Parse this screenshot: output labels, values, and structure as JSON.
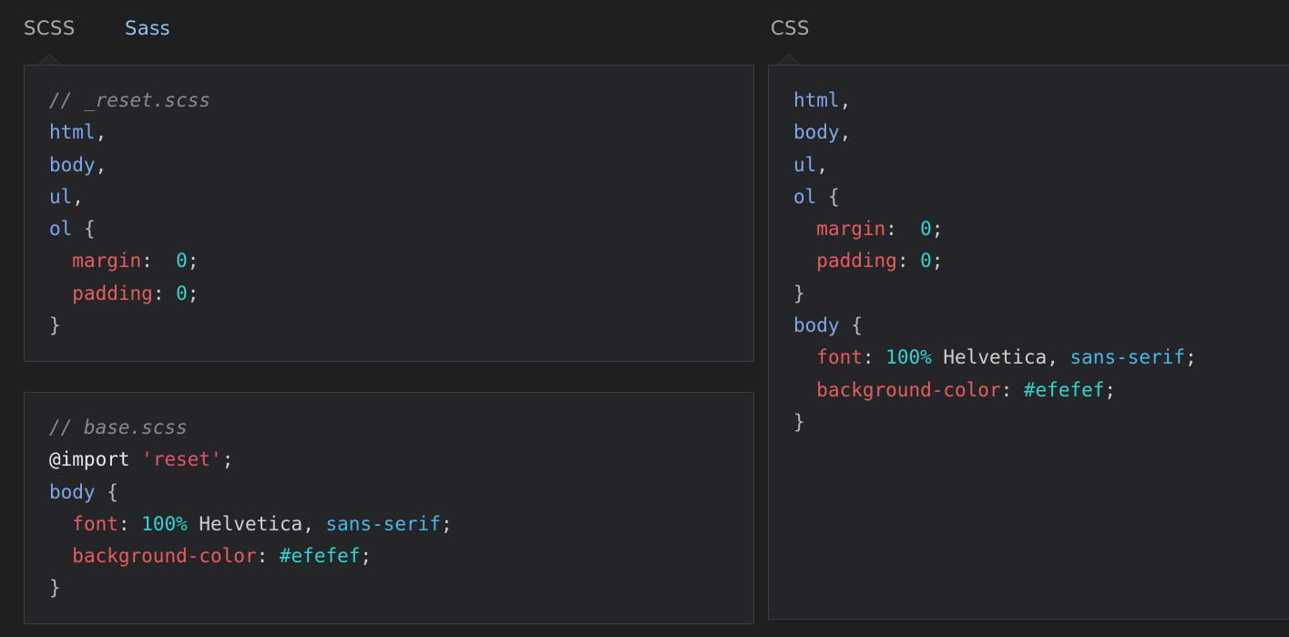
{
  "tabs": {
    "scss": "SCSS",
    "sass": "Sass",
    "css": "CSS"
  },
  "code": {
    "comment_reset": "// _reset.scss",
    "comment_base": "// base.scss",
    "sel_html": "html",
    "sel_body": "body",
    "sel_ul": "ul",
    "sel_ol": "ol",
    "comma": ",",
    "open_brace": "{",
    "close_brace": "}",
    "prop_margin": "margin",
    "prop_padding": "padding",
    "prop_font": "font",
    "prop_bgcolor": "background-color",
    "colon_double": ":  ",
    "colon": ": ",
    "semicolon": ";",
    "zero": "0",
    "import_kw": "@import",
    "import_str": "'reset'",
    "font_size": "100%",
    "font_family": "Helvetica",
    "font_generic": "sans-serif",
    "hex_color": "#efefef"
  },
  "colors": {
    "background": "#1e1f21",
    "panel": "#242528",
    "active_tab": "#8fc3ee",
    "property": "#e85c5c",
    "selector": "#7fa7e6",
    "number": "#2fd5cf"
  }
}
